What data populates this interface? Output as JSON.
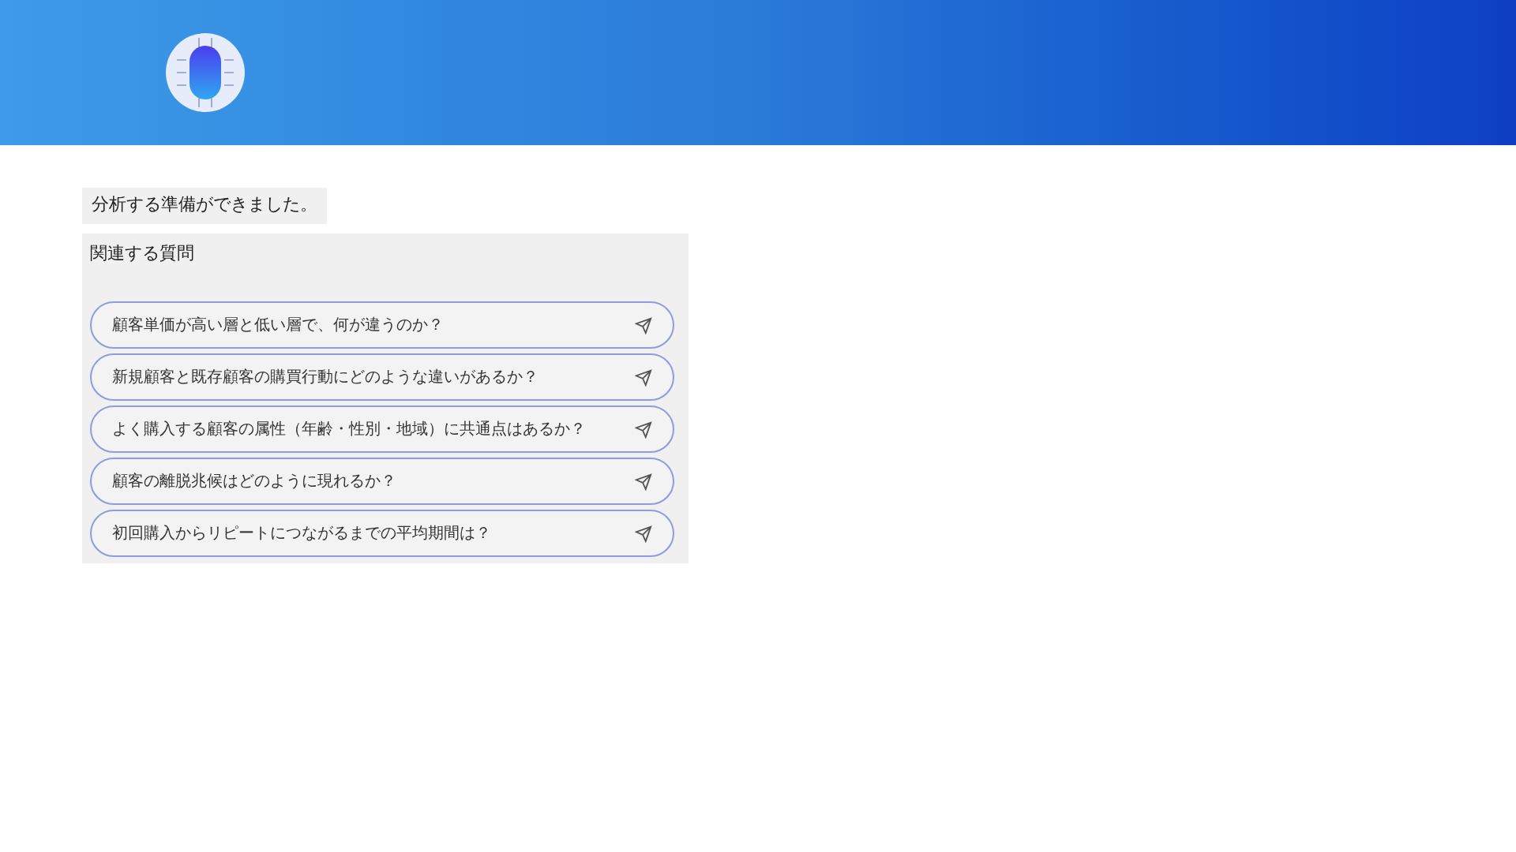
{
  "message": "分析する準備ができました。",
  "related": {
    "title": "関連する質問",
    "questions": [
      "顧客単価が高い層と低い層で、何が違うのか？",
      "新規顧客と既存顧客の購買行動にどのような違いがあるか？",
      "よく購入する顧客の属性（年齢・性別・地域）に共通点はあるか？",
      "顧客の離脱兆候はどのように現れるか？",
      "初回購入からリピートにつながるまでの平均期間は？"
    ]
  }
}
